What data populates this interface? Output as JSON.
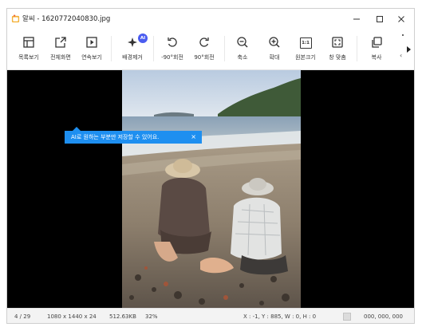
{
  "window": {
    "title": "알씨 - 1620772040830.jpg",
    "controls": {
      "minimize": "minimize",
      "maximize": "maximize",
      "close": "close"
    }
  },
  "toolbar": {
    "items": [
      {
        "label": "목록보기",
        "icon": "list-view-icon"
      },
      {
        "label": "전체화면",
        "icon": "fullscreen-icon"
      },
      {
        "label": "연속보기",
        "icon": "slideshow-icon"
      },
      {
        "label": "배경제거",
        "icon": "background-remove-icon",
        "badge": "AI"
      },
      {
        "label": "-90°회전",
        "icon": "rotate-left-icon"
      },
      {
        "label": "90°회전",
        "icon": "rotate-right-icon"
      },
      {
        "label": "축소",
        "icon": "zoom-out-icon"
      },
      {
        "label": "확대",
        "icon": "zoom-in-icon"
      },
      {
        "label": "원본크기",
        "icon": "original-size-icon",
        "glyph": "1:1"
      },
      {
        "label": "창 맞춤",
        "icon": "fit-window-icon"
      },
      {
        "label": "복사",
        "icon": "copy-icon"
      }
    ],
    "more_label": "‹"
  },
  "tooltip": {
    "text": "AI로 원하는 부분만 저장할 수 있어요.",
    "close": "×",
    "color": "#1e8ff0"
  },
  "status": {
    "page": "4 / 29",
    "dimensions": "1080 x 1440 x 24",
    "filesize": "512.63KB",
    "zoom": "32%",
    "cursor": "X : -1, Y : 885, W : 0, H : 0",
    "color_value": "000, 000, 000"
  },
  "colors": {
    "viewer_bg": "#000000",
    "accent": "#4a5cf0"
  }
}
